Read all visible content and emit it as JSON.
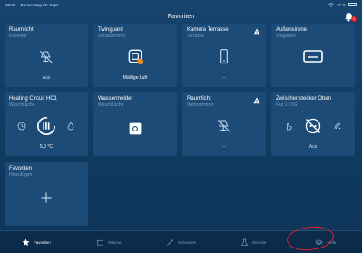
{
  "status_bar": {
    "time": "18:30",
    "date": "Donnerstag 29. Sept.",
    "battery": "47 %"
  },
  "header": {
    "title": "Favoriten",
    "notification_count": "1"
  },
  "tiles": [
    {
      "title": "Raumlicht",
      "subtitle": "Kellerflur",
      "status": "Aus",
      "icon": "light-off-icon"
    },
    {
      "title": "Twinguard",
      "subtitle": "Schlafzimmer",
      "status": "Mäßige Luft",
      "icon": "twinguard-icon"
    },
    {
      "title": "Kamera Terrasse",
      "subtitle": "Terrasse",
      "status": "--",
      "icon": "camera-icon",
      "warning": true
    },
    {
      "title": "Außensirene",
      "subtitle": "Vorgarten",
      "status": "",
      "icon": "siren-icon"
    },
    {
      "title": "Heating Circuit HC1",
      "subtitle": "Waschküche",
      "status": "5,0 °C",
      "icon": "heating-icon"
    },
    {
      "title": "Wassermelder",
      "subtitle": "Waschküche",
      "status": "",
      "icon": "water-detector-icon"
    },
    {
      "title": "Raumlicht",
      "subtitle": "Wohnzimmer",
      "status": "--",
      "icon": "light-off-icon",
      "warning": true
    },
    {
      "title": "Zwischenstecker Oben",
      "subtitle": "Flur 1. OG",
      "status": "Aus",
      "icon": "plug-icon"
    },
    {
      "title": "Favoriten",
      "subtitle": "Hinzufügen",
      "status": "",
      "icon": "plus-icon"
    }
  ],
  "tabs": [
    {
      "label": "Favoriten",
      "icon": "star-icon",
      "active": true
    },
    {
      "label": "Räume",
      "icon": "rooms-icon",
      "active": false
    },
    {
      "label": "Szenarien",
      "icon": "scenarios-icon",
      "active": false
    },
    {
      "label": "Dienste",
      "icon": "services-icon",
      "active": false
    },
    {
      "label": "Mehr",
      "icon": "more-icon",
      "active": false
    }
  ],
  "colors": {
    "background": "#123a63",
    "tile": "#1c4b78",
    "subtitle": "#7f9fc0",
    "annotation": "#e0202a"
  }
}
